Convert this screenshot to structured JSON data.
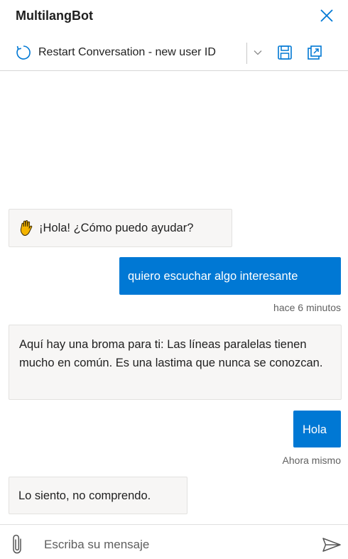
{
  "header": {
    "title": "MultilangBot"
  },
  "toolbar": {
    "restart_label": "Restart Conversation - new user ID"
  },
  "messages": [
    {
      "from": "bot",
      "text": "¡Hola! ¿Cómo puedo ayudar?"
    },
    {
      "from": "user",
      "text": "quiero escuchar algo interesante",
      "timestamp": "hace 6 minutos"
    },
    {
      "from": "bot",
      "text": "Aquí hay una broma para ti: Las líneas paralelas tienen mucho en común. Es una lastima que nunca se conozcan."
    },
    {
      "from": "user",
      "text": "Hola",
      "timestamp": "Ahora mismo"
    },
    {
      "from": "bot",
      "text": "Lo siento, no comprendo."
    }
  ],
  "input": {
    "placeholder": "Escriba su mensaje",
    "value": ""
  },
  "icons": {
    "close": "close-icon",
    "restart": "restart-icon",
    "dropdown": "chevron-down-icon",
    "save": "save-icon",
    "popout": "popout-icon",
    "wave": "waving-hand-icon",
    "attach": "paperclip-icon",
    "send": "send-icon"
  },
  "colors": {
    "accent": "#0078d4",
    "user_bubble": "#0078d4",
    "bot_bubble": "#f7f6f5"
  }
}
